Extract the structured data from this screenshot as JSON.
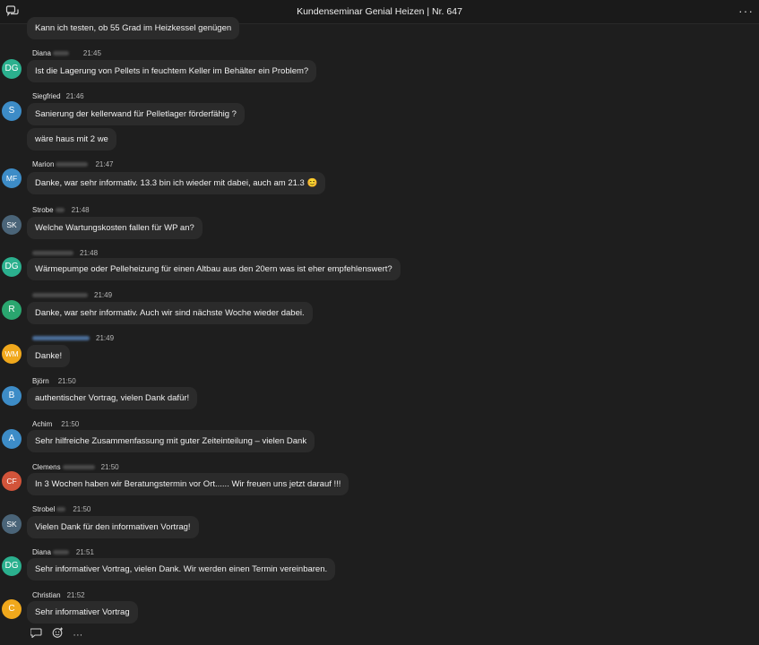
{
  "header": {
    "title": "Kundenseminar Genial Heizen | Nr. 647",
    "left_icon": "chat-bubbles-icon",
    "right_icon": "more-horizontal-icon",
    "more_glyph": "···"
  },
  "colors": {
    "background": "#1e1e1e",
    "bubble": "#2b2b2b",
    "teal": "#2bb08e",
    "blue": "#3d8cc7",
    "slate": "#4a6478",
    "green": "#2aa66f",
    "amber": "#f0a81c",
    "red": "#d2543a"
  },
  "messages": [
    {
      "text": "Kann ich testen, ob 55 Grad im Heizkessel genügen"
    },
    {
      "initials": "DG",
      "avatar_color": "#2bb08e",
      "name": "Diana",
      "time": "21:45",
      "text": "Ist die Lagerung von Pellets in feuchtem Keller im Behälter ein Problem?"
    },
    {
      "initials": "S",
      "avatar_color": "#3d8cc7",
      "name": "Siegfried",
      "time": "21:46",
      "text": "Sanierung der kellerwand für Pelletlager förderfähig ?"
    },
    {
      "text": "wäre haus mit 2 we"
    },
    {
      "initials": "MF",
      "avatar_color": "#3d8cc7",
      "name": "Marion",
      "time": "21:47",
      "text": "Danke, war sehr informativ. 13.3 bin ich wieder mit dabei, auch am 21.3 😊"
    },
    {
      "initials": "SK",
      "avatar_color": "#4a6478",
      "name": "Strobe",
      "time": "21:48",
      "text": "Welche Wartungskosten fallen für WP an?"
    },
    {
      "initials": "DG",
      "avatar_color": "#2bb08e",
      "name": "",
      "time": "21:48",
      "text": "Wärmepumpe oder Pelleheizung für einen Altbau aus den 20ern was ist eher empfehlenswert?"
    },
    {
      "initials": "R",
      "avatar_color": "#2aa66f",
      "name": "",
      "time": "21:49",
      "text": "Danke, war sehr informativ. Auch wir sind nächste Woche wieder dabei."
    },
    {
      "initials": "WM",
      "avatar_color": "#f0a81c",
      "name": "",
      "time": "21:49",
      "text": "Danke!"
    },
    {
      "initials": "B",
      "avatar_color": "#3d8cc7",
      "name": "Björn",
      "time": "21:50",
      "text": "authentischer Vortrag, vielen Dank dafür!"
    },
    {
      "initials": "A",
      "avatar_color": "#3d8cc7",
      "name": "Achim",
      "time": "21:50",
      "text": "Sehr hilfreiche Zusammenfassung mit guter Zeiteinteilung – vielen Dank"
    },
    {
      "initials": "CF",
      "avatar_color": "#d2543a",
      "name": "Clemens",
      "time": "21:50",
      "text": "In 3 Wochen haben wir Beratungstermin vor Ort...... Wir freuen uns jetzt darauf  !!!"
    },
    {
      "initials": "SK",
      "avatar_color": "#4a6478",
      "name": "Strobel",
      "time": "21:50",
      "text": "Vielen Dank für den informativen Vortrag!"
    },
    {
      "initials": "DG",
      "avatar_color": "#2bb08e",
      "name": "Diana",
      "time": "21:51",
      "text": "Sehr informativer Vortrag, vielen Dank. Wir werden einen Termin vereinbaren."
    },
    {
      "initials": "C",
      "avatar_color": "#f0a81c",
      "name": "Christian",
      "time": "21:52",
      "text": "Sehr informativer Vortrag"
    }
  ],
  "footer": {
    "icons": [
      "reply-icon",
      "add-reaction-icon",
      "more-icon"
    ],
    "more_glyph": "···"
  }
}
